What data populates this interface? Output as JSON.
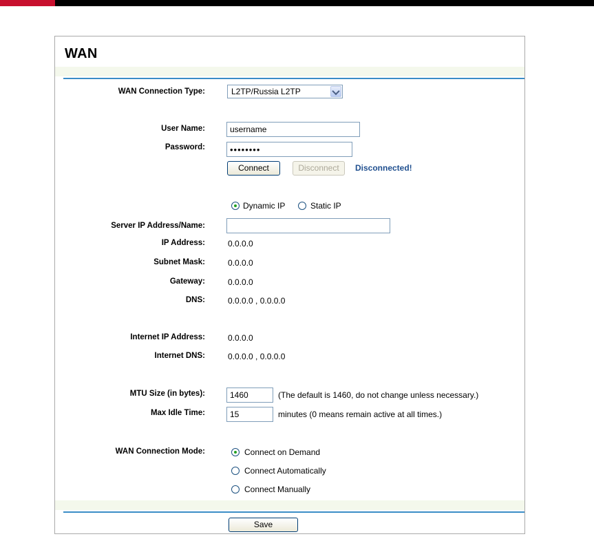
{
  "page": {
    "title": "WAN"
  },
  "wan_type": {
    "label": "WAN Connection Type:",
    "selected": "L2TP/Russia L2TP"
  },
  "user_name": {
    "label": "User Name:",
    "value": "username"
  },
  "password": {
    "label": "Password:",
    "value": "••••••••"
  },
  "connect_button": "Connect",
  "disconnect_button": "Disconnect",
  "connection_status": "Disconnected!",
  "ip_mode": {
    "dynamic": "Dynamic IP",
    "static": "Static IP",
    "selected": "Dynamic IP"
  },
  "server": {
    "label": "Server IP Address/Name:",
    "value": ""
  },
  "ip_address": {
    "label": "IP Address:",
    "value": "0.0.0.0"
  },
  "subnet_mask": {
    "label": "Subnet Mask:",
    "value": "0.0.0.0"
  },
  "gateway": {
    "label": "Gateway:",
    "value": "0.0.0.0"
  },
  "dns": {
    "label": "DNS:",
    "value": "0.0.0.0 , 0.0.0.0"
  },
  "internet_ip": {
    "label": "Internet IP Address:",
    "value": "0.0.0.0"
  },
  "internet_dns": {
    "label": "Internet DNS:",
    "value": "0.0.0.0 , 0.0.0.0"
  },
  "mtu": {
    "label": "MTU Size (in bytes):",
    "value": "1460",
    "hint": "(The default is 1460, do not change unless necessary.)"
  },
  "max_idle": {
    "label": "Max Idle Time:",
    "value": "15",
    "hint": "minutes (0 means remain active at all times.)"
  },
  "connection_mode": {
    "label": "WAN Connection Mode:",
    "options": [
      "Connect on Demand",
      "Connect Automatically",
      "Connect Manually"
    ],
    "selected": "Connect on Demand"
  },
  "save_button": "Save",
  "colors": {
    "rule": "#3a8cc6",
    "band": "#f4f8ec",
    "status": "#1f4f8f",
    "brand_accent": "#c8102e"
  }
}
